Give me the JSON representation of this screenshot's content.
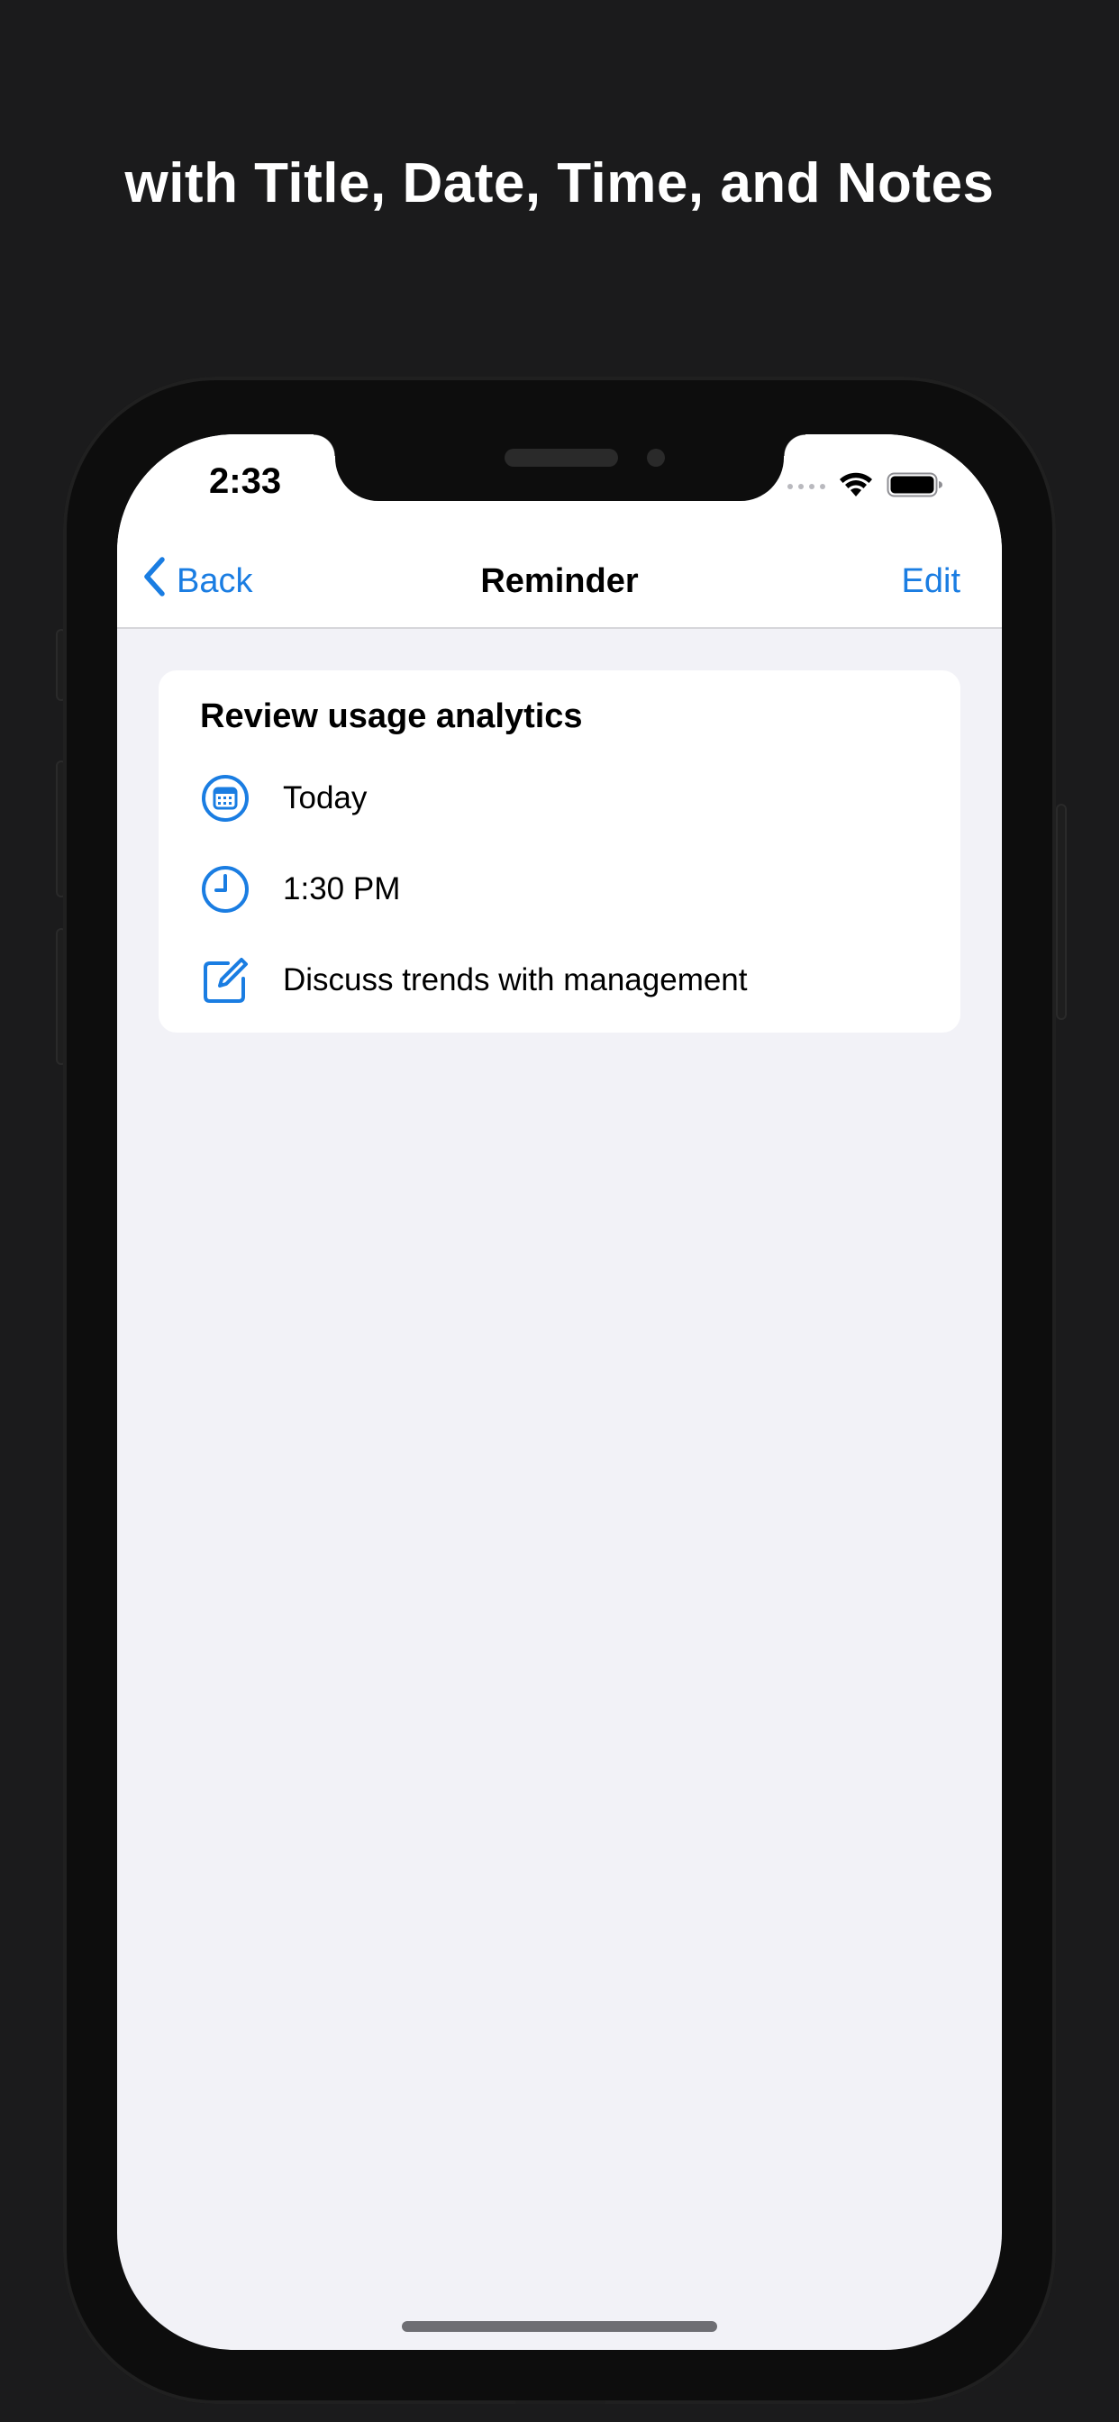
{
  "headline": "with Title, Date, Time, and Notes",
  "status_bar": {
    "time": "2:33"
  },
  "nav": {
    "back_label": "Back",
    "title": "Reminder",
    "edit_label": "Edit"
  },
  "reminder": {
    "title": "Review usage analytics",
    "date": "Today",
    "time": "1:30 PM",
    "notes": "Discuss trends with management"
  },
  "colors": {
    "accent": "#1a7de2",
    "background": "#1b1b1c",
    "screen_background": "#f2f2f7",
    "card_background": "#ffffff"
  },
  "icons": {
    "back": "chevron-left-icon",
    "date": "calendar-icon",
    "time": "clock-icon",
    "notes": "edit-note-icon",
    "wifi": "wifi-icon",
    "battery": "battery-icon"
  }
}
